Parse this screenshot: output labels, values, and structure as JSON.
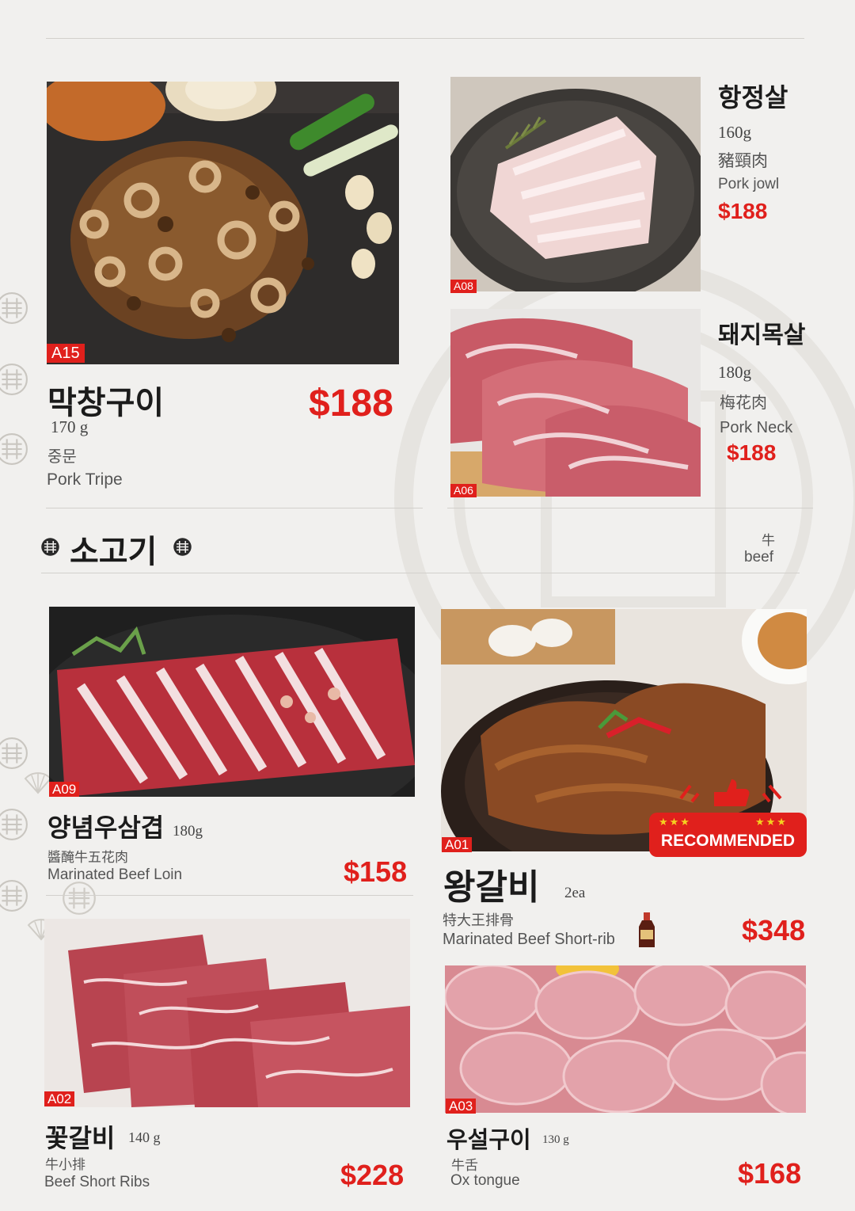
{
  "colors": {
    "accent": "#e0201c",
    "background": "#f1f0ee",
    "rule": "#d2d0cc",
    "text": "#1b1b1b"
  },
  "section": {
    "title": "소고기",
    "cjk": "牛",
    "en": "beef"
  },
  "recommended_badge": "RECOMMENDED",
  "items": {
    "a15": {
      "code": "A15",
      "name": "막창구이",
      "weight": "170 g",
      "cjk": "중문",
      "en": "Pork Tripe",
      "price": "$188"
    },
    "a08": {
      "code": "A08",
      "name": "항정살",
      "weight": "160g",
      "cjk": "豬頸肉",
      "en": "Pork jowl",
      "price": "$188"
    },
    "a06": {
      "code": "A06",
      "name": "돼지목살",
      "weight": "180g",
      "cjk": "梅花肉",
      "en": "Pork Neck",
      "price": "$188"
    },
    "a09": {
      "code": "A09",
      "name": "양념우삼겹",
      "weight": "180g",
      "cjk": "醬醃牛五花肉",
      "en": "Marinated Beef Loin",
      "price": "$158"
    },
    "a01": {
      "code": "A01",
      "name": "왕갈비",
      "weight": "2ea",
      "cjk": "特大王排骨",
      "en": "Marinated Beef Short-rib",
      "price": "$348"
    },
    "a02": {
      "code": "A02",
      "name": "꽃갈비",
      "weight": "140 g",
      "cjk": "牛小排",
      "en": "Beef Short Ribs",
      "price": "$228"
    },
    "a03": {
      "code": "A03",
      "name": "우설구이",
      "weight": "130 g",
      "cjk": "牛舌",
      "en": "Ox tongue",
      "price": "$168"
    }
  }
}
